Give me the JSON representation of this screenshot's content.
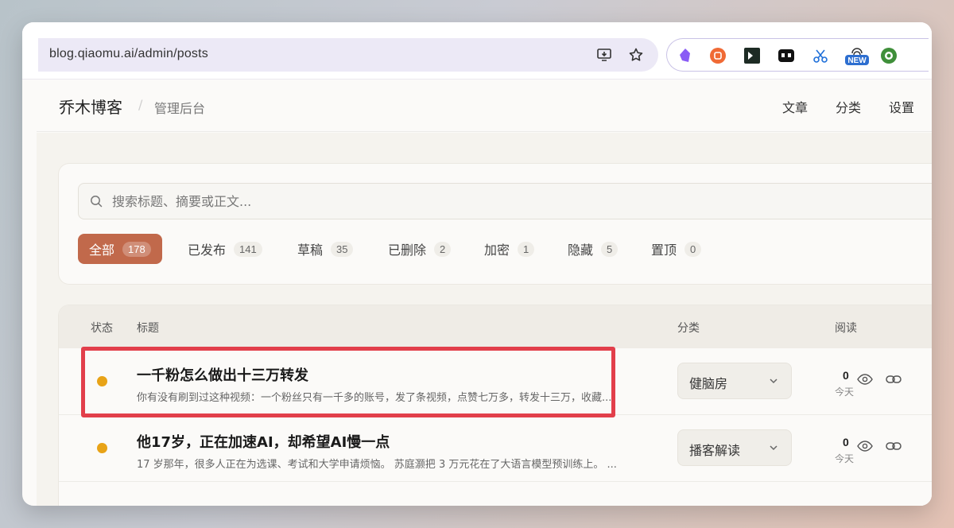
{
  "browser": {
    "url": "blog.qiaomu.ai/admin/posts",
    "extensions": [
      "obsidian-icon",
      "orange-circle-icon",
      "terminal-icon",
      "video-icon",
      "scissors-icon",
      "new-fingerprint-icon",
      "green-coin-icon"
    ],
    "new_badge": "NEW"
  },
  "header": {
    "brand": "乔木博客",
    "separator": "/",
    "subtitle": "管理后台",
    "nav": [
      "文章",
      "分类",
      "设置"
    ]
  },
  "search": {
    "placeholder": "搜索标题、摘要或正文..."
  },
  "filters": [
    {
      "label": "全部",
      "count": "178",
      "active": true
    },
    {
      "label": "已发布",
      "count": "141"
    },
    {
      "label": "草稿",
      "count": "35"
    },
    {
      "label": "已删除",
      "count": "2"
    },
    {
      "label": "加密",
      "count": "1"
    },
    {
      "label": "隐藏",
      "count": "5"
    },
    {
      "label": "置顶",
      "count": "0"
    }
  ],
  "table": {
    "columns": [
      "状态",
      "标题",
      "分类",
      "阅读"
    ],
    "rows": [
      {
        "title": "一千粉怎么做出十三万转发",
        "excerpt": "你有没有刷到过这种视频：一个粉丝只有一千多的账号，发了条视频，点赞七万多，转发十三万，收藏...",
        "category": "健脑房",
        "views": "0",
        "when": "今天"
      },
      {
        "title": "他17岁，正在加速AI，却希望AI慢一点",
        "excerpt": "17 岁那年，很多人正在为选课、考试和大学申请烦恼。 苏庭灏把 3 万元花在了大语言模型预训练上。 ...",
        "category": "播客解读",
        "views": "0",
        "when": "今天"
      }
    ]
  },
  "colors": {
    "accent": "#c1694b",
    "status_draft": "#e8a317",
    "highlight": "#e23f4b"
  }
}
